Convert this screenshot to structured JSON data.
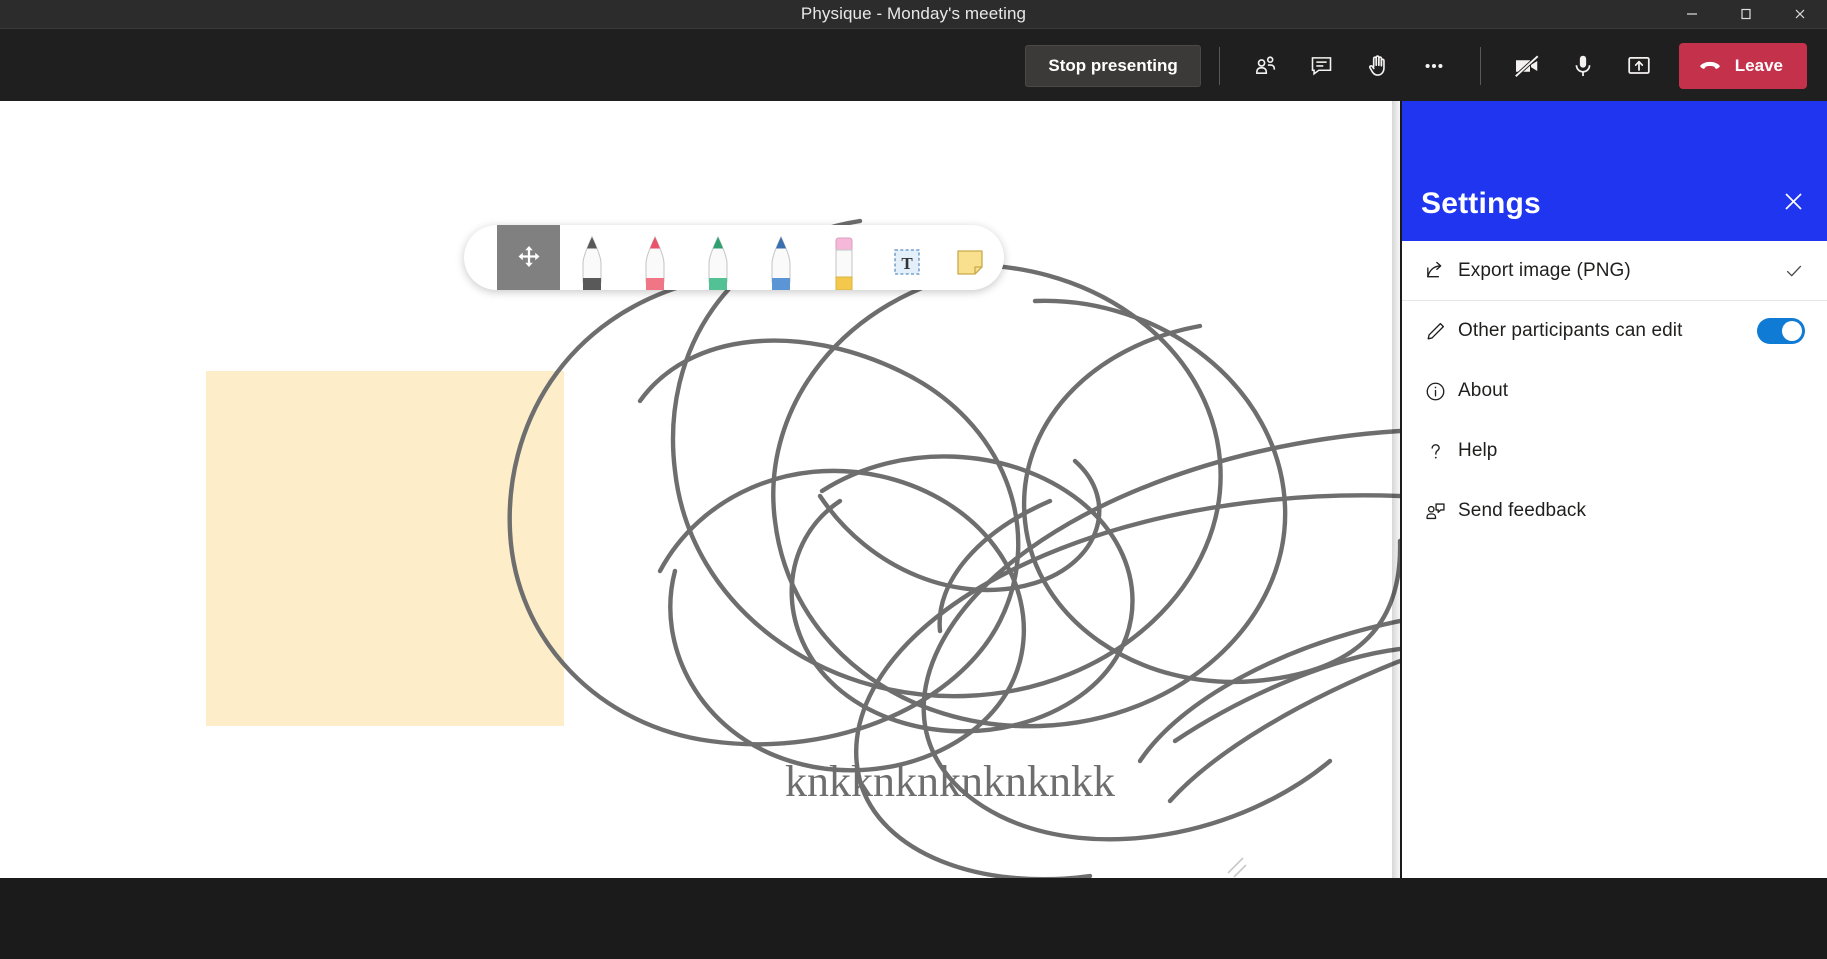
{
  "window": {
    "title": "Physique - Monday's meeting",
    "controls": [
      {
        "name": "minimize",
        "glyph": "minimize-icon"
      },
      {
        "name": "maximize",
        "glyph": "maximize-icon"
      },
      {
        "name": "close",
        "glyph": "close-icon"
      }
    ]
  },
  "meeting_bar": {
    "stop_presenting_label": "Stop presenting",
    "leave_label": "Leave",
    "icons": [
      {
        "name": "people-icon",
        "title": "Show participants"
      },
      {
        "name": "chat-icon",
        "title": "Show conversation"
      },
      {
        "name": "raise-hand-icon",
        "title": "Raise hand"
      },
      {
        "name": "more-options-icon",
        "title": "More actions"
      },
      {
        "name": "camera-off-icon",
        "title": "Turn camera on"
      },
      {
        "name": "microphone-icon",
        "title": "Mute"
      },
      {
        "name": "share-screen-icon",
        "title": "Share content"
      },
      {
        "name": "hangup-icon",
        "title": "Leave"
      }
    ],
    "accent_red": "#c4314b"
  },
  "whiteboard": {
    "tools": [
      {
        "name": "move-tool",
        "label": "Move",
        "icon": "move-arrows-icon",
        "selected": true,
        "color": "#808080"
      },
      {
        "name": "pen-black",
        "label": "Black pen",
        "icon": "pen-icon",
        "color": "#595959",
        "selected": false
      },
      {
        "name": "pen-red",
        "label": "Red pen",
        "icon": "pen-icon",
        "color": "#e8546a",
        "selected": false
      },
      {
        "name": "pen-green",
        "label": "Green pen",
        "icon": "pen-icon",
        "color": "#3bb178",
        "selected": false
      },
      {
        "name": "pen-blue",
        "label": "Blue pen",
        "icon": "pen-icon",
        "color": "#4a86c8",
        "selected": false
      },
      {
        "name": "eraser-tool",
        "label": "Eraser",
        "icon": "eraser-icon",
        "color": "#f5b8d8",
        "selected": false
      },
      {
        "name": "text-tool",
        "label": "Text",
        "icon": "text-t-icon",
        "color": "#d9eaf7",
        "selected": false
      },
      {
        "name": "note-tool",
        "label": "Sticky note",
        "icon": "sticky-note-icon",
        "color": "#f8e08e",
        "selected": false
      }
    ],
    "sticky_note": {
      "color": "#fdeec9",
      "text": ""
    },
    "ink_text": "knkknknknknknkk",
    "ink_color": "#6e6e6e"
  },
  "settings": {
    "title": "Settings",
    "header_color": "#1f35f0",
    "close_label": "Close",
    "items": [
      {
        "name": "export-image",
        "label": "Export image (PNG)",
        "icon": "share-export-icon",
        "trailing": "check"
      },
      {
        "name": "other-participants-can-edit",
        "label": "Other participants can edit",
        "icon": "pencil-icon",
        "trailing": "toggle",
        "toggle_on": true
      },
      {
        "name": "about",
        "label": "About",
        "icon": "info-icon",
        "trailing": "none"
      },
      {
        "name": "help",
        "label": "Help",
        "icon": "question-icon",
        "trailing": "none"
      },
      {
        "name": "send-feedback",
        "label": "Send feedback",
        "icon": "feedback-person-icon",
        "trailing": "none"
      }
    ]
  }
}
